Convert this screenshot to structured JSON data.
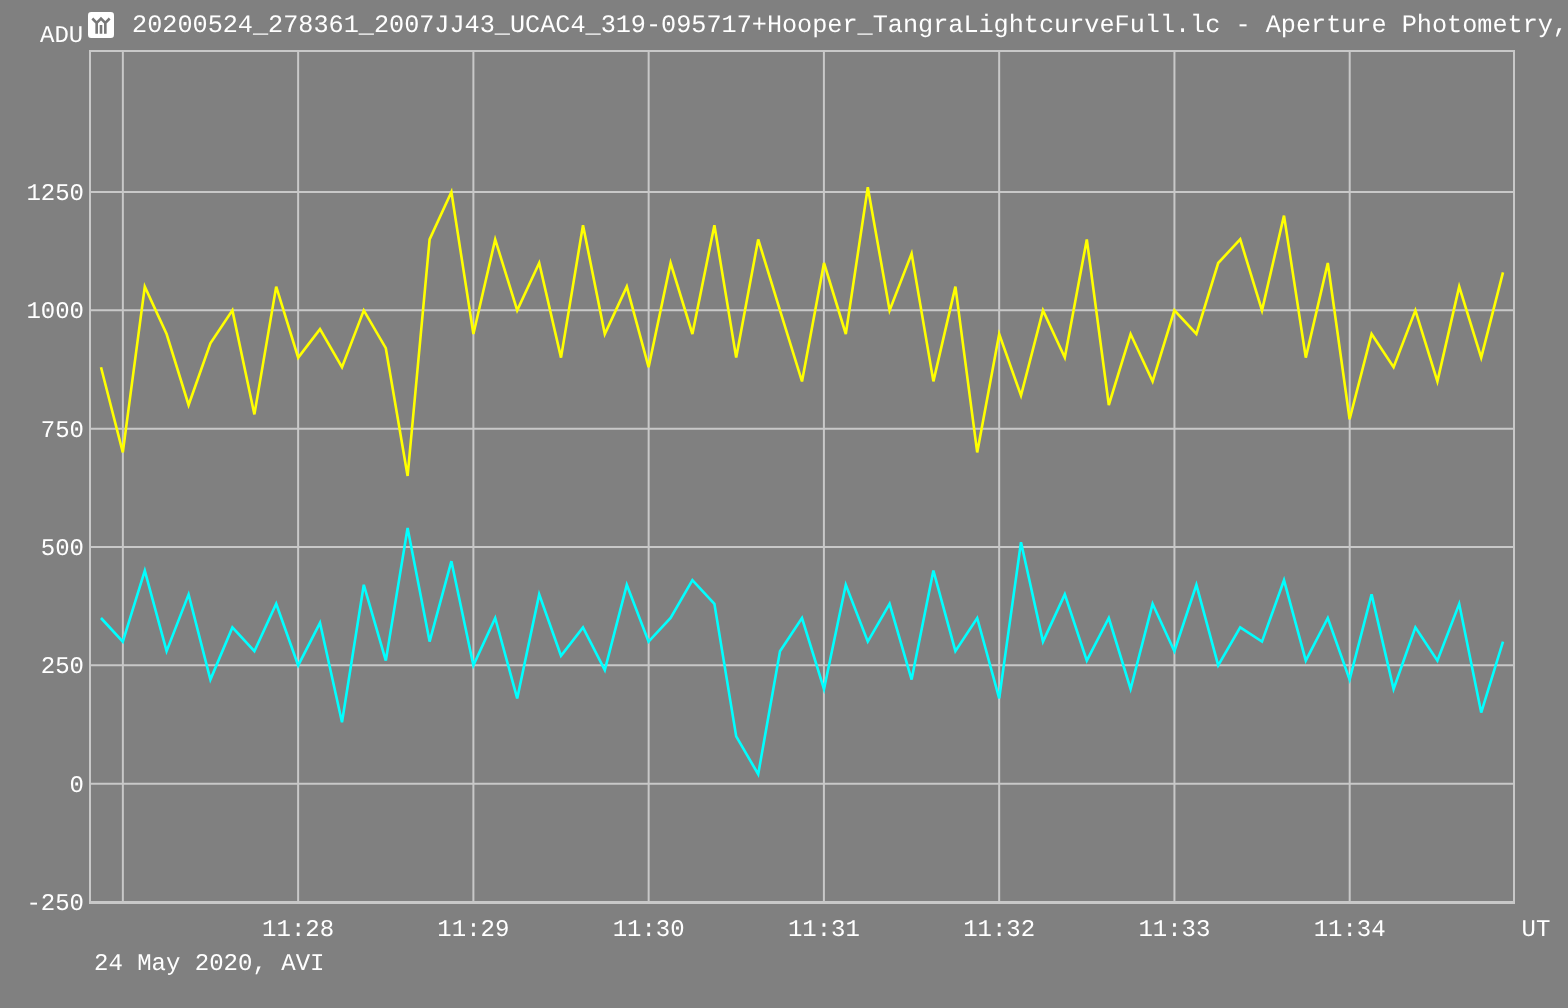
{
  "window": {
    "title": "20200524_278361_2007JJ43_UCAC4_319-095717+Hooper_TangraLightcurveFull.lc - Aperture Photometry,"
  },
  "plot": {
    "chart_data": {
      "type": "line",
      "grid": true,
      "ylabel": "ADU",
      "xlabel": "UT",
      "ylim": [
        -250,
        1550
      ],
      "yticks": [
        1250,
        1000,
        750,
        500,
        250,
        0,
        -250
      ],
      "categories": [
        null,
        null,
        null,
        null,
        null,
        null,
        null,
        null,
        null,
        "11:28",
        null,
        null,
        null,
        null,
        null,
        null,
        null,
        "11:29",
        null,
        null,
        null,
        null,
        null,
        null,
        null,
        "11:30",
        null,
        null,
        null,
        null,
        null,
        null,
        null,
        "11:31",
        null,
        null,
        null,
        null,
        null,
        null,
        null,
        "11:32",
        null,
        null,
        null,
        null,
        null,
        null,
        null,
        "11:33",
        null,
        null,
        null,
        null,
        null,
        null,
        null,
        "11:34",
        null,
        null,
        null,
        null,
        null,
        null,
        null
      ],
      "series": [
        {
          "color": "#ffff00",
          "values": [
            880,
            700,
            1050,
            950,
            800,
            930,
            1000,
            780,
            1050,
            900,
            960,
            880,
            1000,
            920,
            650,
            1150,
            1250,
            950,
            1150,
            1000,
            1100,
            900,
            1180,
            950,
            1050,
            880,
            1100,
            950,
            1180,
            900,
            1150,
            1000,
            850,
            1100,
            950,
            1260,
            1000,
            1120,
            850,
            1050,
            700,
            950,
            820,
            1000,
            900,
            1150,
            800,
            950,
            850,
            1000,
            950,
            1100,
            1150,
            1000,
            1200,
            900,
            1100,
            770,
            950,
            880,
            1000,
            850,
            1050,
            900,
            1080
          ]
        },
        {
          "color": "#00ffff",
          "values": [
            350,
            300,
            450,
            280,
            400,
            220,
            330,
            280,
            380,
            250,
            340,
            130,
            420,
            260,
            540,
            300,
            470,
            250,
            350,
            180,
            400,
            270,
            330,
            240,
            420,
            300,
            350,
            430,
            380,
            100,
            20,
            280,
            350,
            200,
            420,
            300,
            380,
            220,
            450,
            280,
            350,
            180,
            510,
            300,
            400,
            260,
            350,
            200,
            380,
            280,
            420,
            250,
            330,
            300,
            430,
            260,
            350,
            220,
            400,
            200,
            330,
            260,
            380,
            150,
            300
          ]
        }
      ]
    }
  },
  "footer": "24 May 2020, AVI"
}
